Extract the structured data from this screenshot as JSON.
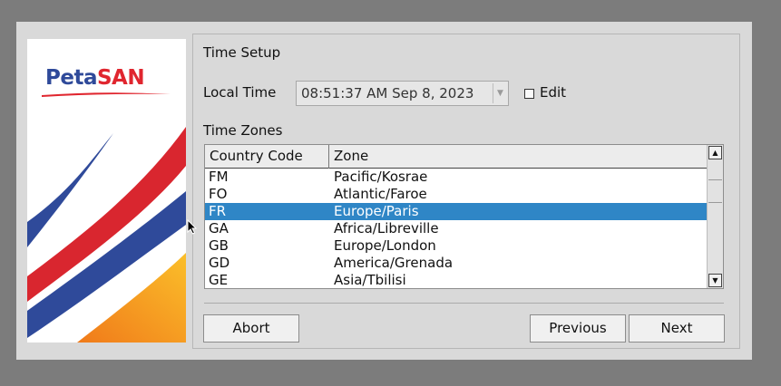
{
  "logo": {
    "part1": "Peta",
    "part2": "SAN"
  },
  "header": {
    "title": "Time  Setup"
  },
  "local_time": {
    "label": "Local Time",
    "value": "08:51:37 AM  Sep 8, 2023",
    "edit_label": "Edit",
    "edit_checked": false
  },
  "time_zones": {
    "label": "Time Zones",
    "columns": [
      "Country Code",
      "Zone"
    ],
    "rows": [
      {
        "code": "FM",
        "zone": "Pacific/Kosrae"
      },
      {
        "code": "FO",
        "zone": "Atlantic/Faroe"
      },
      {
        "code": "FR",
        "zone": "Europe/Paris",
        "selected": true
      },
      {
        "code": "GA",
        "zone": "Africa/Libreville"
      },
      {
        "code": "GB",
        "zone": "Europe/London"
      },
      {
        "code": "GD",
        "zone": "America/Grenada"
      },
      {
        "code": "GE",
        "zone": "Asia/Tbilisi"
      }
    ]
  },
  "buttons": {
    "abort": "Abort",
    "previous": "Previous",
    "next": "Next"
  },
  "colors": {
    "selection": "#2f86c6",
    "logo_blue": "#2f4a9a",
    "logo_red": "#e0262f",
    "logo_orange": "#f39a1e"
  }
}
